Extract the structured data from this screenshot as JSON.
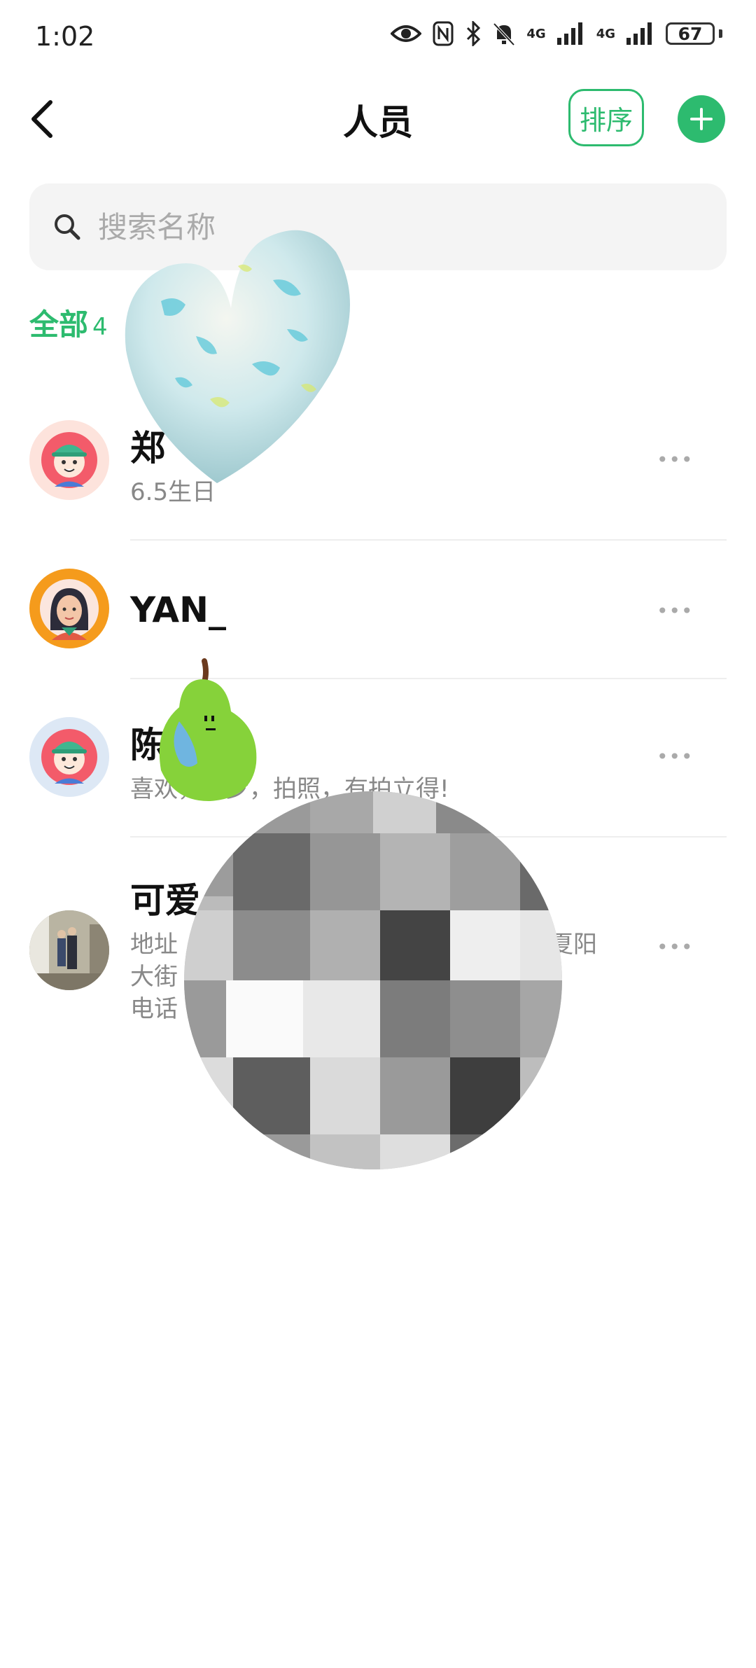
{
  "status_bar": {
    "time": "1:02",
    "battery": "67",
    "net_1": "4G",
    "net_2": "4G"
  },
  "header": {
    "title": "人员",
    "sort_label": "排序",
    "add_label": "+"
  },
  "search": {
    "placeholder": "搜索名称"
  },
  "tab": {
    "label": "全部",
    "count": "4"
  },
  "contacts": [
    {
      "name": "郑",
      "subtitle": "6.5生日",
      "more": "•••"
    },
    {
      "name": "YAN_",
      "subtitle": "",
      "more": "•••"
    },
    {
      "name": "陈",
      "subtitle": "喜欢，徒步，拍照，有拍立得!",
      "more": "•••"
    },
    {
      "name": "可爱",
      "subtitle_lines": [
        "地址",
        "大街",
        "电话"
      ],
      "subtitle_right": "夏阳",
      "more": "•••"
    }
  ],
  "colors": {
    "accent": "#2dbb6f",
    "muted": "#888888"
  }
}
